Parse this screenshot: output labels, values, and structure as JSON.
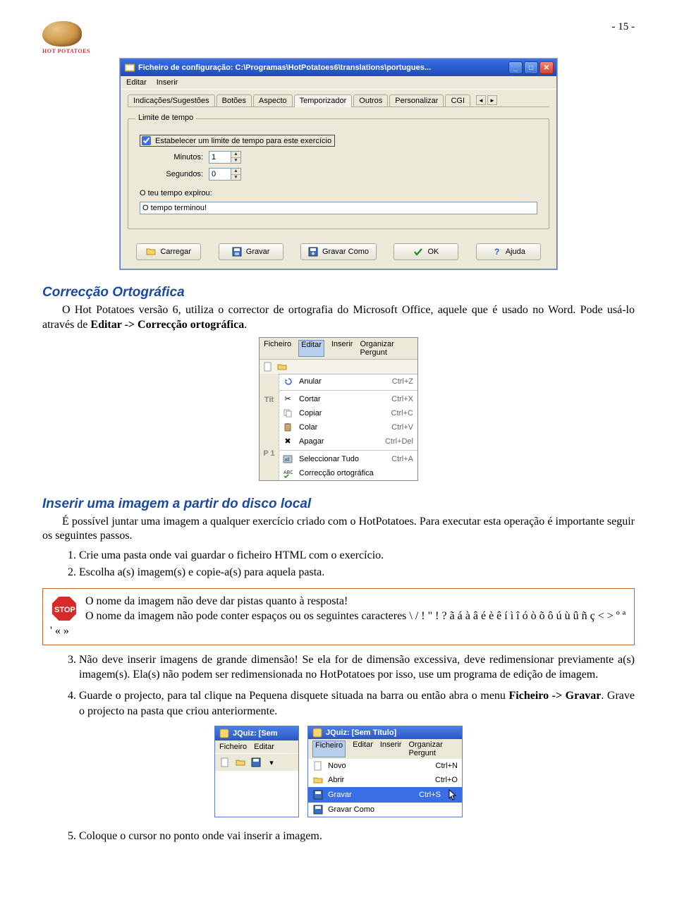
{
  "page": {
    "num": "- 15 -"
  },
  "logo": {
    "label": "HOT POTATOES"
  },
  "win1": {
    "title": "Ficheiro de configuração: C:\\Programas\\HotPotatoes6\\translations\\portugues...",
    "menu": [
      "Editar",
      "Inserir"
    ],
    "tabs": [
      "Indicações/Sugestões",
      "Botões",
      "Aspecto",
      "Temporizador",
      "Outros",
      "Personalizar",
      "CGI"
    ],
    "group_legend": "Limite de tempo",
    "checkbox_label": "Estabelecer um limite de tempo para este exercício",
    "minutos_label": "Minutos:",
    "minutos_value": "1",
    "segundos_label": "Segundos:",
    "segundos_value": "0",
    "expirou_label": "O teu tempo expirou:",
    "expirou_value": "O tempo terminou!",
    "buttons": {
      "carregar": "Carregar",
      "gravar": "Gravar",
      "gravar_como": "Gravar Como",
      "ok": "OK",
      "ajuda": "Ajuda"
    }
  },
  "sec1": {
    "title": "Correcção Ortográfica",
    "para": "O Hot Potatoes versão 6, utiliza o corrector de ortografia do Microsoft Office, aquele que é usado no Word. Pode usá-lo através de ",
    "bold": "Editar -> Correcção ortográfica",
    "period": "."
  },
  "editmenu": {
    "bar": [
      "Ficheiro",
      "Editar",
      "Inserir",
      "Organizar Pergunt"
    ],
    "left_open": "Tít",
    "left_p1": "P 1",
    "items": [
      {
        "icon": "undo",
        "label": "Anular",
        "short": "Ctrl+Z"
      },
      {
        "sep": true
      },
      {
        "icon": "cut",
        "label": "Cortar",
        "short": "Ctrl+X"
      },
      {
        "icon": "copy",
        "label": "Copiar",
        "short": "Ctrl+C"
      },
      {
        "icon": "paste",
        "label": "Colar",
        "short": "Ctrl+V"
      },
      {
        "icon": "delete",
        "label": "Apagar",
        "short": "Ctrl+Del"
      },
      {
        "sep": true
      },
      {
        "icon": "selectall",
        "label": "Seleccionar Tudo",
        "short": "Ctrl+A"
      },
      {
        "icon": "spell",
        "label": "Correcção ortográfica",
        "short": ""
      }
    ]
  },
  "sec2": {
    "title": "Inserir uma imagem a partir do disco local",
    "para": "É possível juntar uma imagem a qualquer exercício criado com o HotPotatoes. Para executar esta operação é importante seguir os seguintes passos.",
    "steps": [
      "Crie uma pasta onde vai guardar o ficheiro HTML com o exercício.",
      "Escolha a(s) imagem(s) e copie-a(s) para aquela pasta."
    ]
  },
  "stopbox": {
    "l1": "O nome da imagem não deve dar pistas quanto à resposta!",
    "l2": "O nome da imagem não pode conter espaços ou os seguintes caracteres \\ / ! \" ! ? ã á à â é è ê í ì î ó ò õ ô ú ù û ñ ç < > º ª ' « »"
  },
  "cont": {
    "s3a": "Não deve inserir imagens de grande dimensão! Se ela for de dimensão excessiva, deve redimensionar previamente a(s) imagem(s). Ela(s) não podem ser redimensionada no HotPotatoes por isso, use um programa de edição de imagem.",
    "s4a": "Guarde o projecto, para tal clique na Pequena disquete situada na barra ou então abra o menu ",
    "s4b": "Ficheiro -> Gravar",
    "s4c": ". Grave o projecto na pasta que criou anteriormente.",
    "s5": "Coloque o cursor no ponto onde vai inserir a imagem."
  },
  "jq1": {
    "title": "JQuiz: [Sem",
    "menu": [
      "Ficheiro",
      "Editar"
    ]
  },
  "jq2": {
    "title": "JQuiz: [Sem Título]",
    "menu": [
      "Ficheiro",
      "Editar",
      "Inserir",
      "Organizar Pergunt"
    ],
    "items": [
      {
        "icon": "new",
        "label": "Novo",
        "short": "Ctrl+N"
      },
      {
        "icon": "open",
        "label": "Abrir",
        "short": "Ctrl+O"
      },
      {
        "icon": "save",
        "label": "Gravar",
        "short": "Ctrl+S",
        "sel": true
      },
      {
        "icon": "saveas",
        "label": "Gravar Como",
        "short": ""
      }
    ]
  }
}
